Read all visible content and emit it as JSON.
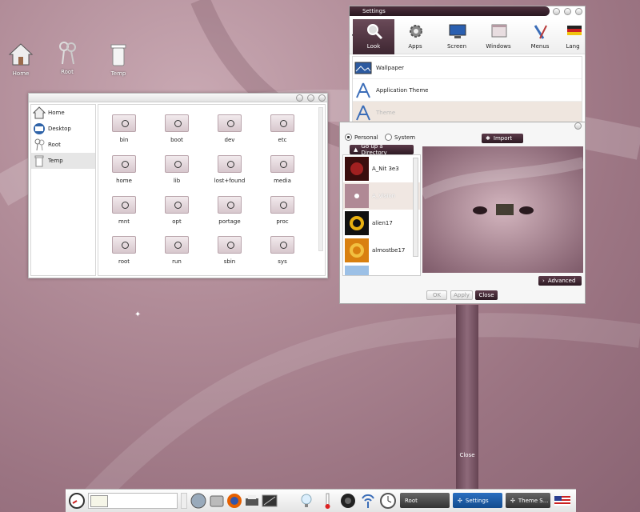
{
  "desktop": {
    "icons": [
      {
        "label": "Home",
        "icon": "home-icon"
      },
      {
        "label": "Root",
        "icon": "keys-icon"
      },
      {
        "label": "Temp",
        "icon": "trash-icon"
      }
    ]
  },
  "file_manager": {
    "sidebar": [
      {
        "label": "Home",
        "icon": "home-icon"
      },
      {
        "label": "Desktop",
        "icon": "desktop-icon"
      },
      {
        "label": "Root",
        "icon": "keys-icon"
      },
      {
        "label": "Temp",
        "icon": "trash-icon"
      }
    ],
    "folders": [
      "bin",
      "boot",
      "dev",
      "etc",
      "home",
      "lib",
      "lost+found",
      "media",
      "mnt",
      "opt",
      "portage",
      "proc",
      "root",
      "run",
      "sbin",
      "sys"
    ]
  },
  "settings": {
    "title": "Settings",
    "tabs": [
      "Look",
      "Apps",
      "Screen",
      "Windows",
      "Menus",
      "Lang"
    ],
    "items": [
      "Wallpaper",
      "Application Theme",
      "Theme"
    ]
  },
  "theme_panel": {
    "radio_personal": "Personal",
    "radio_system": "System",
    "import_label": "Import",
    "go_up_label": "Go up a Directory",
    "themes": [
      "A_Nit 3e3",
      "A_Vision",
      "alien17",
      "almostbe17",
      ""
    ],
    "advanced_label": "Advanced",
    "ok_label": "OK",
    "apply_label": "Apply",
    "close_label": "Close"
  },
  "close_strip_label": "Close",
  "taskbar": {
    "tasks": [
      "Root",
      "Settings",
      "Theme S..."
    ]
  },
  "colors": {
    "accent": "#3d2631",
    "wallpaper": "#b18c98",
    "selected_task": "#1b5fa8"
  }
}
